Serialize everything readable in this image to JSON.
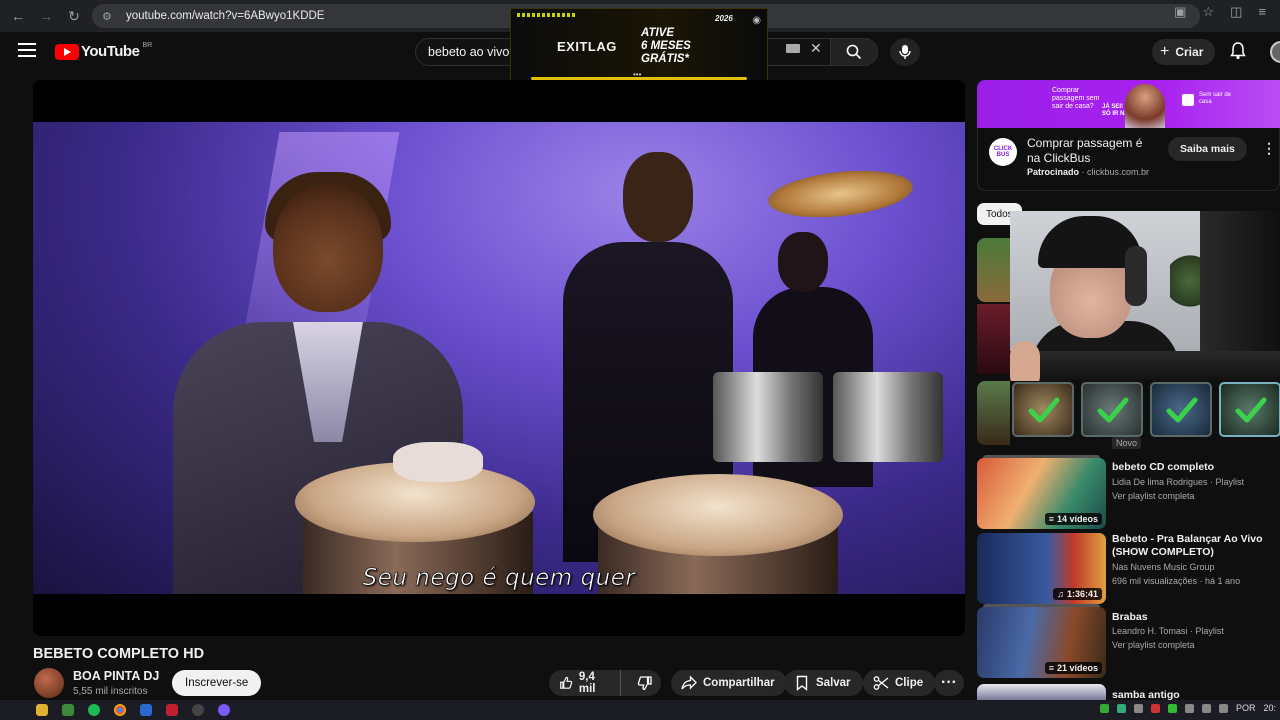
{
  "browser": {
    "url": "youtube.com/watch?v=6ABwyo1KDDE"
  },
  "header": {
    "logo_text": "YouTube",
    "region": "BR",
    "search_query": "bebeto ao vivo",
    "create_label": "Criar"
  },
  "ad_overlay": {
    "year": "2026",
    "brand": "EXITLAG",
    "offer_line1": "ATIVE",
    "offer_line2": "6 MESES",
    "offer_line3": "GRÁTIS*"
  },
  "video": {
    "subtitle": "Seu nego é quem quer",
    "title": "BEBETO COMPLETO HD",
    "channel": "BOA PINTA DJ",
    "subscribers": "5,55 mil inscritos",
    "subscribe_label": "Inscrever-se",
    "likes": "9,4 mil",
    "share_label": "Compartilhar",
    "save_label": "Salvar",
    "clip_label": "Clipe"
  },
  "sponsor": {
    "banner_text1": "Comprar passagem sem sair de casa?",
    "banner_text2": "JÁ SEI! É SÓ IR NA",
    "banner_text3": "Sem sair de casa",
    "logo_text": "CLICK BUS",
    "title": "Comprar passagem é na ClickBus",
    "label": "Patrocinado",
    "domain": "clickbus.com.br",
    "button": "Saiba mais"
  },
  "chips": [
    {
      "label": "Todos"
    }
  ],
  "novo_label": "Novo",
  "recommendations": [
    {
      "title": "bebeto CD completo",
      "line1": "Lidia De lima Rodrigues · Playlist",
      "line2": "Ver playlist completa",
      "badge": "14 vídeos"
    },
    {
      "title": "Bebeto - Pra Balançar Ao Vivo (SHOW COMPLETO)",
      "line1": "Nas Nuvens Music Group",
      "line2": "696 mil visualizações · há 1 ano",
      "badge": "1:36:41"
    },
    {
      "title": "Brabas",
      "line1": "Leandro H. Tomasi · Playlist",
      "line2": "Ver playlist completa",
      "badge": "21 vídeos"
    },
    {
      "title": "samba antigo"
    }
  ],
  "taskbar": {
    "lang": "POR",
    "time": "20:"
  }
}
